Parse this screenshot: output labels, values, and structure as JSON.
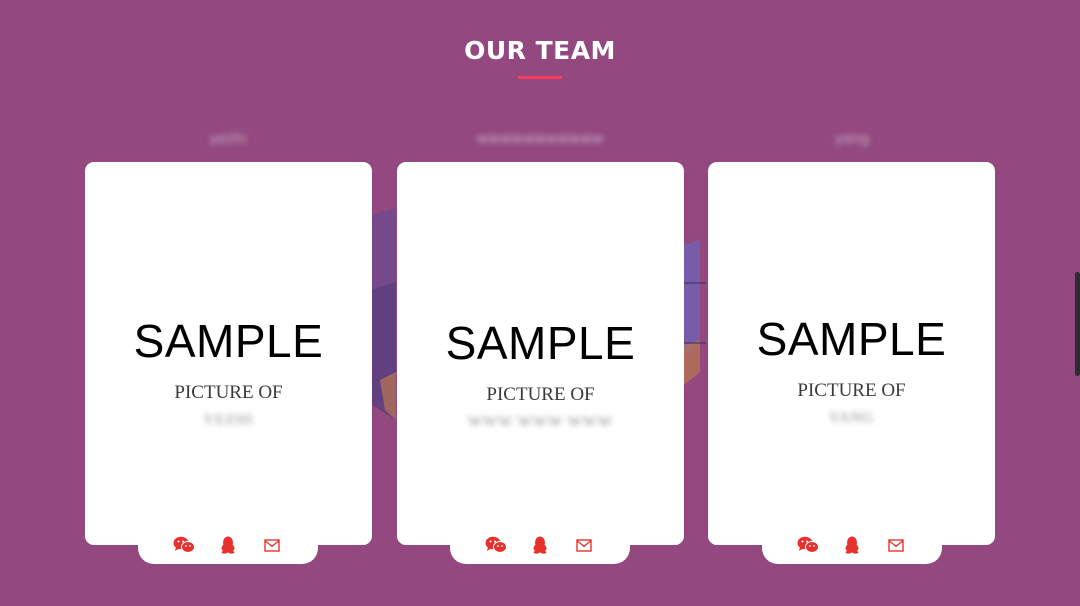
{
  "section": {
    "title": "OUR TEAM",
    "accent_color": "#ff3a5c",
    "background_color": "#93497f"
  },
  "members": [
    {
      "name": "yezhi",
      "sample_text": "SAMPLE",
      "picture_of": "PICTURE OF",
      "caption_name": "YEZHI",
      "icons": [
        "wechat-icon",
        "qq-icon",
        "mail-icon"
      ]
    },
    {
      "name": "wwwwwwwwwww",
      "sample_text": "SAMPLE",
      "picture_of": "PICTURE OF",
      "caption_name": "WWW WWW WWW",
      "icons": [
        "wechat-icon",
        "qq-icon",
        "mail-icon"
      ]
    },
    {
      "name": "yang",
      "sample_text": "SAMPLE",
      "picture_of": "PICTURE OF",
      "caption_name": "YANG",
      "icons": [
        "wechat-icon",
        "qq-icon",
        "mail-icon"
      ]
    }
  ],
  "icon_color": "#e5322d"
}
